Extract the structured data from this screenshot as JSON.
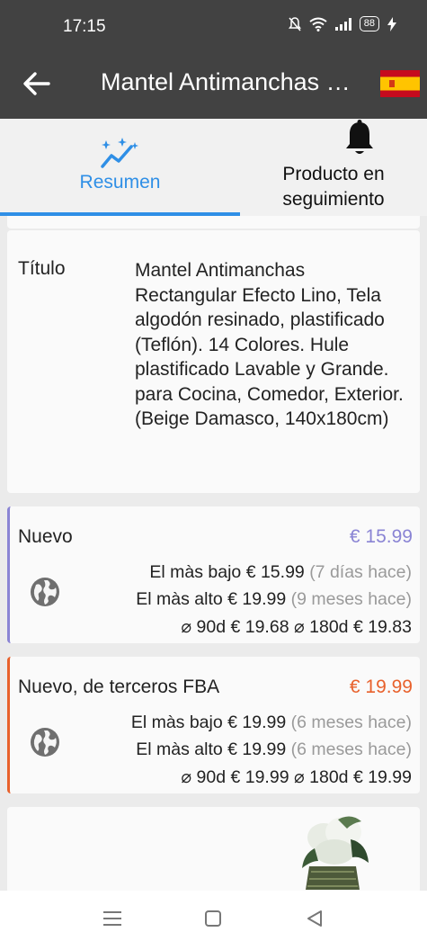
{
  "status_bar": {
    "time": "17:15",
    "battery": "88"
  },
  "app_bar": {
    "title": "Mantel Antimanchas R..."
  },
  "tabs": [
    {
      "label": "Resumen"
    },
    {
      "label": "Producto en seguimiento"
    }
  ],
  "title_card": {
    "label": "Título",
    "value": "Mantel Antimanchas Rectangular Efecto Lino, Tela algodón resinado, plastificado (Teflón). 14 Colores. Hule plastificado Lavable y Grande.\npara Cocina, Comedor, Exterior.(Beige Damasco, 140x180cm)"
  },
  "offers": [
    {
      "name": "Nuevo",
      "price": "€ 15.99",
      "low_label": "El màs bajo",
      "low_price": "€ 15.99",
      "low_when": "(7 días hace)",
      "high_label": "El màs alto",
      "high_price": "€ 19.99",
      "high_when": "(9 meses hace)",
      "avg90_label": "⌀ 90d",
      "avg90": "€ 19.68",
      "avg180_label": "⌀ 180d",
      "avg180": "€ 19.83",
      "color": "#8a84d4"
    },
    {
      "name": "Nuevo, de terceros FBA",
      "price": "€ 19.99",
      "low_label": "El màs bajo",
      "low_price": "€ 19.99",
      "low_when": "(6 meses hace)",
      "high_label": "El màs alto",
      "high_price": "€ 19.99",
      "high_when": "(6 meses hace)",
      "avg90_label": "⌀ 90d",
      "avg90": "€ 19.99",
      "avg180_label": "⌀ 180d",
      "avg180": "€ 19.99",
      "color": "#e8612c"
    }
  ],
  "icons": {
    "back": "arrow-left-icon",
    "flag": "spain-flag-icon",
    "tab_summary": "trend-sparkle-icon",
    "tab_tracking": "bell-icon",
    "market": "globe-icon",
    "nav": [
      "menu-icon",
      "home-square-icon",
      "back-triangle-icon"
    ]
  },
  "colors": {
    "accent": "#2f8fe6",
    "header": "#424242"
  }
}
